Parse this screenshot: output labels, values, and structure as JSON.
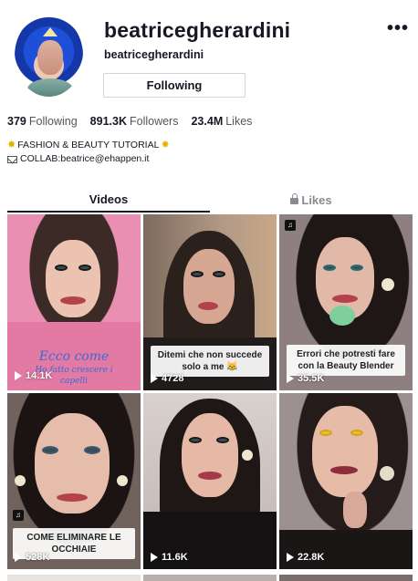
{
  "profile": {
    "username": "beatricegherardini",
    "nickname": "beatricegherardini",
    "follow_label": "Following",
    "more_icon": "ellipsis-icon"
  },
  "stats": {
    "following_count": "379",
    "following_label": "Following",
    "followers_count": "891.3K",
    "followers_label": "Followers",
    "likes_count": "23.4M",
    "likes_label": "Likes"
  },
  "bio": {
    "line1_text": "FASHION & BEAUTY TUTORIAL",
    "line1_icon": "sparkle-icon",
    "line2_text": "COLLAB:beatrice@ehappen.it",
    "line2_icon": "mail-icon"
  },
  "tabs": {
    "videos": "Videos",
    "likes": "Likes",
    "likes_icon": "lock-icon"
  },
  "videos": [
    {
      "views": "14.1K",
      "caption_title": "Ecco come",
      "caption_sub": "Ho fatto crescere i",
      "caption_sub2": "capelli",
      "bg": "#e88fb2"
    },
    {
      "views": "4728",
      "caption": "Ditemi che non succede solo a me 😹",
      "bg": "#a08a7a"
    },
    {
      "views": "35.5K",
      "caption": "Errori che potresti fare con la Beauty Blender",
      "bg": "#6a5b5c"
    },
    {
      "views": "528K",
      "caption": "COME ELIMINARE LE OCCHIAIE",
      "bg": "#5e5550"
    },
    {
      "views": "11.6K",
      "caption": "",
      "bg": "#cfc6c2"
    },
    {
      "views": "22.8K",
      "caption": "",
      "bg": "#8f8585"
    }
  ],
  "colors": {
    "text": "#161823",
    "muted": "#8a8b91",
    "border": "#d4d4d8",
    "accent_yellow": "#e0b400"
  }
}
